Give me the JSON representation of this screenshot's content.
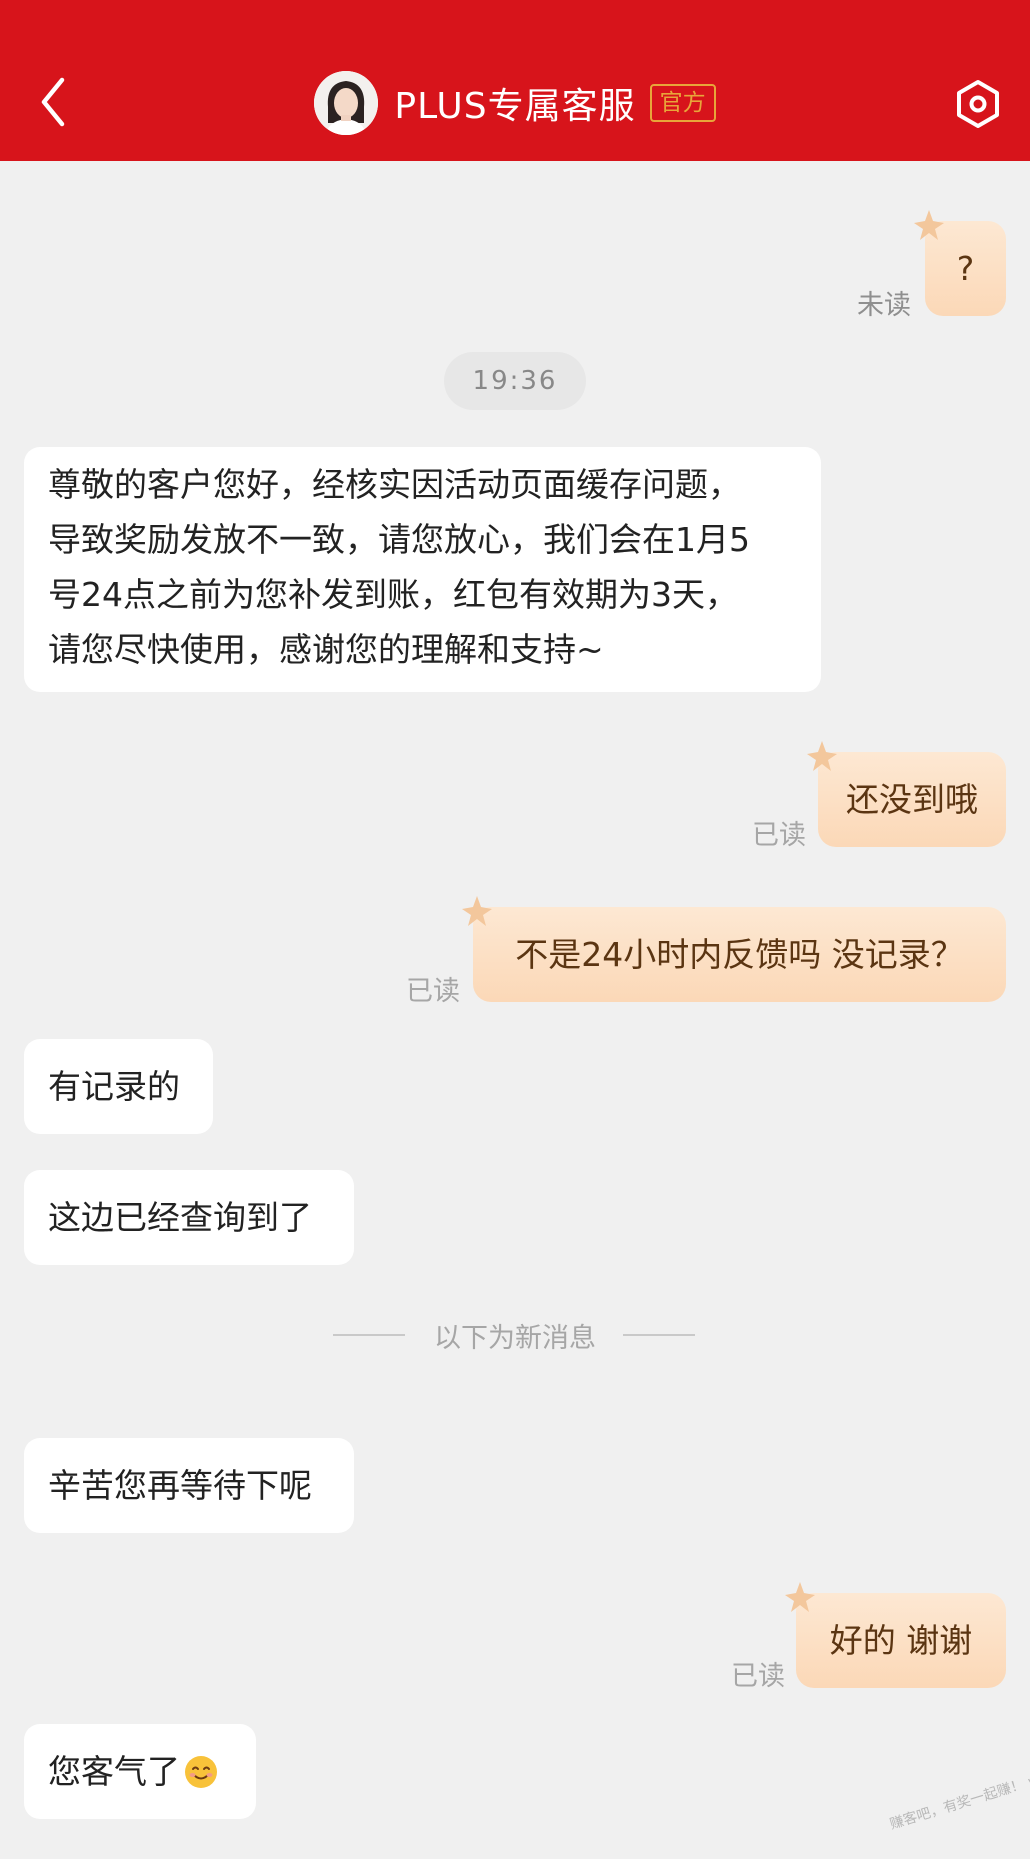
{
  "header": {
    "title": "PLUS专属客服",
    "badge": "官方"
  },
  "colors": {
    "header_bg": "#d7141b",
    "badge": "#e8a53a",
    "out_bubble": "#fbd8b7",
    "in_bubble": "#ffffff"
  },
  "icons": [
    "back-icon",
    "settings-icon",
    "avatar",
    "star-icon",
    "smile-emoji-icon"
  ],
  "chat": {
    "msg_q": "?",
    "status_unread": "未读",
    "timestamp": "19:36",
    "msg_reply_long_1": "尊敬的客户您好，经核实因活动页面缓存问题，",
    "msg_reply_long_2": "导致奖励发放不一致，请您放心，我们会在1月5",
    "msg_reply_long_3": "号24点之前为您补发到账，红包有效期为3天，",
    "msg_reply_long_4": "请您尽快使用，感谢您的理解和支持~",
    "msg_not_arrived": "还没到哦",
    "status_read_1": "已读",
    "msg_24h": "不是24小时内反馈吗  没记录？",
    "status_read_2": "已读",
    "msg_has_record": "有记录的",
    "msg_found": "这边已经查询到了",
    "new_messages_divider": "以下为新消息",
    "msg_wait": "辛苦您再等待下呢",
    "msg_ok_thanks": "好的  谢谢",
    "status_read_3": "已读",
    "msg_welcome": "您客气了"
  },
  "watermark": "赚客吧，有奖一起赚！ www.zuanke8.com"
}
